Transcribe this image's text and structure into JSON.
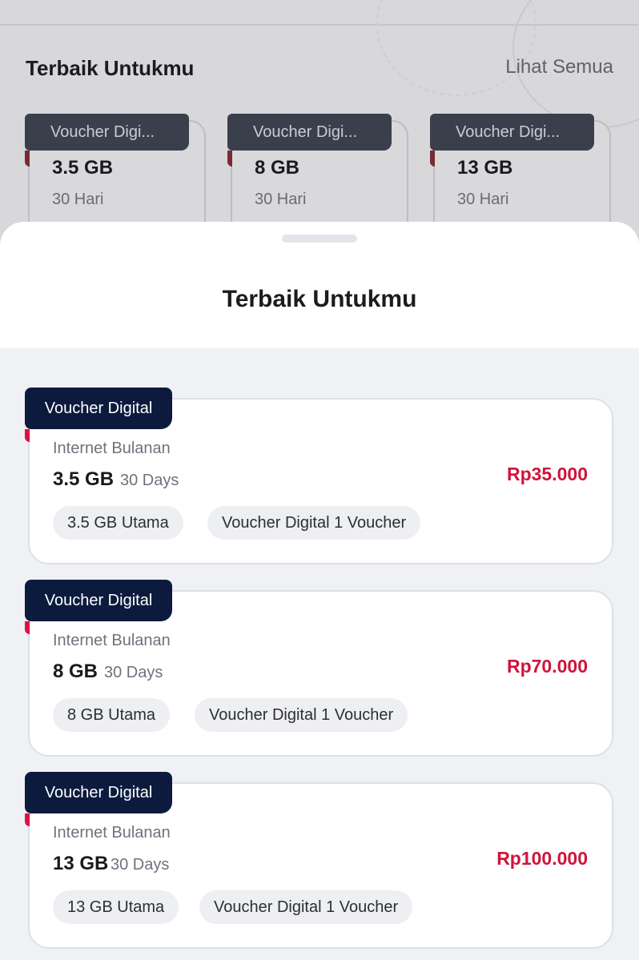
{
  "background": {
    "section_title": "Terbaik Untukmu",
    "see_all_label": "Lihat Semua",
    "cards": [
      {
        "tag": "Voucher Digi...",
        "size": "3.5 GB",
        "days": "30 Hari"
      },
      {
        "tag": "Voucher Digi...",
        "size": "8 GB",
        "days": "30 Hari"
      },
      {
        "tag": "Voucher Digi...",
        "size": "13 GB",
        "days": "30 Hari"
      }
    ]
  },
  "sheet": {
    "title": "Terbaik Untukmu",
    "offers": [
      {
        "tag": "Voucher Digital",
        "category": "Internet Bulanan",
        "size": "3.5 GB",
        "days": "30 Days",
        "price": "Rp35.000",
        "chips": [
          "3.5 GB Utama",
          "Voucher Digital 1 Voucher"
        ]
      },
      {
        "tag": "Voucher Digital",
        "category": "Internet Bulanan",
        "size": "8 GB",
        "days": "30 Days",
        "price": "Rp70.000",
        "chips": [
          "8 GB Utama",
          "Voucher Digital 1 Voucher"
        ]
      },
      {
        "tag": "Voucher Digital",
        "category": "Internet Bulanan",
        "size": "13 GB",
        "days": "30 Days",
        "price": "Rp100.000",
        "chips": [
          "13 GB Utama",
          "Voucher Digital 1 Voucher"
        ]
      }
    ]
  },
  "colors": {
    "tag_bg": "#0c1b3d",
    "price": "#d0143a",
    "accent_fold": "#e0113f",
    "sheet_bg": "#f0f1f5"
  }
}
